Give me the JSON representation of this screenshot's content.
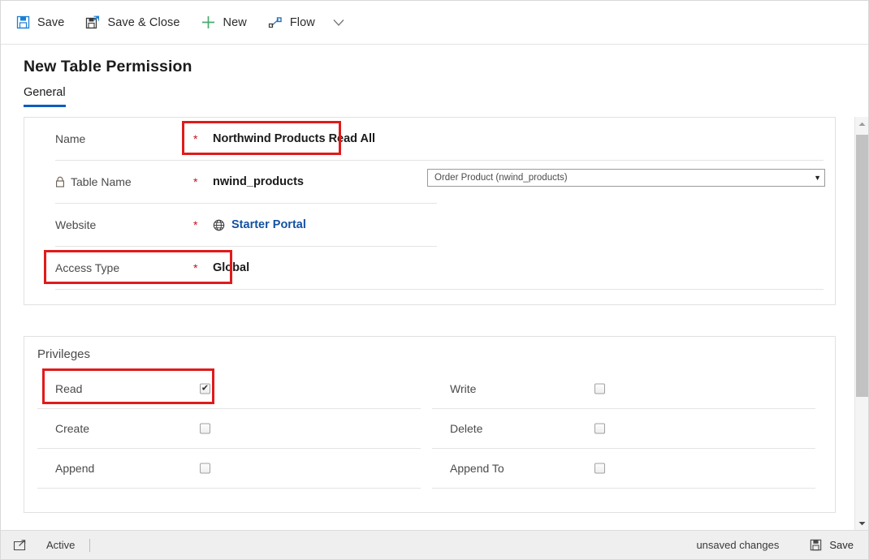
{
  "command_bar": {
    "buttons": [
      {
        "label": "Save",
        "icon": "save-floppy-icon"
      },
      {
        "label": "Save & Close",
        "icon": "save-and-close-icon"
      },
      {
        "label": "New",
        "icon": "plus-icon"
      },
      {
        "label": "Flow",
        "icon": "flow-icon"
      }
    ],
    "overflow_icon": "chevron-down-icon"
  },
  "page": {
    "title": "New Table Permission",
    "tabs": [
      {
        "label": "General",
        "selected": true
      }
    ]
  },
  "general": {
    "rows": [
      {
        "label": "Name",
        "required": "*",
        "value": "Northwind Products Read All",
        "highlighted": true,
        "locked": false
      },
      {
        "label": "Table Name",
        "required": "*",
        "value": "nwind_products",
        "highlighted": false,
        "locked": true
      },
      {
        "label": "Website",
        "required": "*",
        "value": "Starter Portal",
        "highlighted": false,
        "locked": false,
        "link": true,
        "icon": "globe-icon"
      },
      {
        "label": "Access Type",
        "required": "*",
        "value": "Global",
        "highlighted": true,
        "locked": false
      }
    ],
    "lookup": {
      "value": "Order Product (nwind_products)",
      "arrow": "▼"
    }
  },
  "privileges": {
    "title": "Privileges",
    "left_column": [
      {
        "label": "Read",
        "checked": true,
        "highlighted": true
      },
      {
        "label": "Create",
        "checked": false,
        "highlighted": false
      },
      {
        "label": "Append",
        "checked": false,
        "highlighted": false
      }
    ],
    "right_column": [
      {
        "label": "Write",
        "checked": false,
        "highlighted": false
      },
      {
        "label": "Delete",
        "checked": false,
        "highlighted": false
      },
      {
        "label": "Append To",
        "checked": false,
        "highlighted": false
      }
    ],
    "check_glyph": "✔"
  },
  "footer": {
    "status_icon": "open-in-new-window-icon",
    "status": "Active",
    "unsaved": "unsaved changes",
    "save_label": "Save",
    "save_icon": "save-floppy-icon"
  },
  "scrollbar": {
    "up_arrow": "▲",
    "down_arrow": "▼"
  },
  "colors": {
    "accent": "#0b5cc4",
    "link": "#1352a2",
    "required": "#c1121c",
    "highlight": "#e01b1b",
    "new_green": "#4aaa6e"
  }
}
